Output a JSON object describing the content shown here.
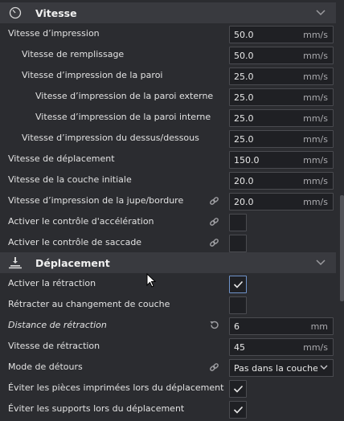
{
  "sections": {
    "speed": {
      "title": "Vitesse",
      "icon": "speedometer-icon"
    },
    "travel": {
      "title": "Déplacement",
      "icon": "travel-icon"
    }
  },
  "speed_rows": [
    {
      "label": "Vitesse d’impression",
      "value": "50.0",
      "unit": "mm/s"
    },
    {
      "label": "Vitesse de remplissage",
      "value": "50.0",
      "unit": "mm/s"
    },
    {
      "label": "Vitesse d’impression de la paroi",
      "value": "25.0",
      "unit": "mm/s"
    },
    {
      "label": "Vitesse d’impression de la paroi externe",
      "value": "25.0",
      "unit": "mm/s"
    },
    {
      "label": "Vitesse d’impression de la paroi interne",
      "value": "25.0",
      "unit": "mm/s"
    },
    {
      "label": "Vitesse d’impression du dessus/dessous",
      "value": "25.0",
      "unit": "mm/s"
    },
    {
      "label": "Vitesse de déplacement",
      "value": "150.0",
      "unit": "mm/s"
    },
    {
      "label": "Vitesse de la couche initiale",
      "value": "20.0",
      "unit": "mm/s"
    },
    {
      "label": "Vitesse d’impression de la jupe/bordure",
      "value": "20.0",
      "unit": "mm/s"
    },
    {
      "label": "Activer le contrôle d'accélération"
    },
    {
      "label": "Activer le contrôle de saccade"
    }
  ],
  "travel_rows": [
    {
      "label": "Activer la rétraction",
      "checked": true
    },
    {
      "label": "Rétracter au changement de couche",
      "checked": false
    },
    {
      "label": "Distance de rétraction",
      "value": "6",
      "unit": "mm"
    },
    {
      "label": "Vitesse de rétraction",
      "value": "45",
      "unit": "mm/s"
    },
    {
      "label": "Mode de détours",
      "value": "Pas dans la couche extérieure"
    },
    {
      "label": "Éviter les pièces imprimées lors du déplacement",
      "checked": true
    },
    {
      "label": "Éviter les supports lors du déplacement",
      "checked": true
    }
  ],
  "colors": {
    "background": "#2b2c30",
    "section": "#393a3f",
    "field": "#1f2024",
    "border": "#4a4b50",
    "accent": "#6f93c9"
  }
}
